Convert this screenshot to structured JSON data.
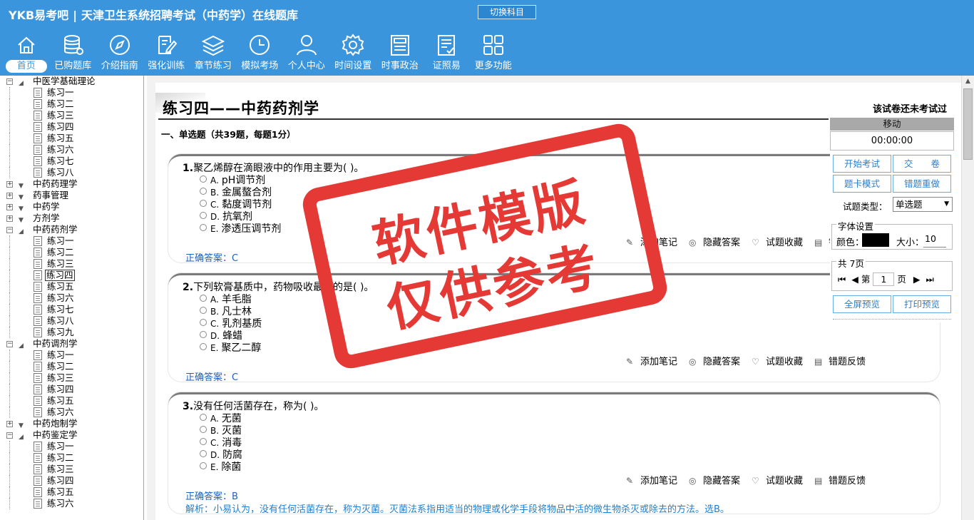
{
  "header": {
    "logo": "YKB易考吧",
    "title": "天津卫生系统招聘考试（中药学）在线题库",
    "switch_button": "切换科目"
  },
  "nav": [
    {
      "label": "首页",
      "icon": "home-icon"
    },
    {
      "label": "已购题库",
      "icon": "database-icon"
    },
    {
      "label": "介绍指南",
      "icon": "compass-icon"
    },
    {
      "label": "强化训练",
      "icon": "edit-icon"
    },
    {
      "label": "章节练习",
      "icon": "layers-icon"
    },
    {
      "label": "模拟考场",
      "icon": "clock-icon"
    },
    {
      "label": "个人中心",
      "icon": "user-icon"
    },
    {
      "label": "时间设置",
      "icon": "gear-icon"
    },
    {
      "label": "时事政治",
      "icon": "newspaper-icon"
    },
    {
      "label": "证照易",
      "icon": "checklist-icon"
    },
    {
      "label": "更多功能",
      "icon": "grid-icon"
    }
  ],
  "tree": [
    {
      "type": "cat",
      "label": "中医学基础理论",
      "expanded": true
    },
    {
      "type": "leaf",
      "label": "练习一"
    },
    {
      "type": "leaf",
      "label": "练习二"
    },
    {
      "type": "leaf",
      "label": "练习三"
    },
    {
      "type": "leaf",
      "label": "练习四"
    },
    {
      "type": "leaf",
      "label": "练习五"
    },
    {
      "type": "leaf",
      "label": "练习六"
    },
    {
      "type": "leaf",
      "label": "练习七"
    },
    {
      "type": "leaf",
      "label": "练习八"
    },
    {
      "type": "cat",
      "label": "中药药理学",
      "expanded": false
    },
    {
      "type": "cat",
      "label": "药事管理",
      "expanded": false
    },
    {
      "type": "cat",
      "label": "中药学",
      "expanded": false
    },
    {
      "type": "cat",
      "label": "方剂学",
      "expanded": false
    },
    {
      "type": "cat",
      "label": "中药药剂学",
      "expanded": true
    },
    {
      "type": "leaf",
      "label": "练习一"
    },
    {
      "type": "leaf",
      "label": "练习二"
    },
    {
      "type": "leaf",
      "label": "练习三"
    },
    {
      "type": "leaf",
      "label": "练习四",
      "selected": true
    },
    {
      "type": "leaf",
      "label": "练习五"
    },
    {
      "type": "leaf",
      "label": "练习六"
    },
    {
      "type": "leaf",
      "label": "练习七"
    },
    {
      "type": "leaf",
      "label": "练习八"
    },
    {
      "type": "leaf",
      "label": "练习九"
    },
    {
      "type": "cat",
      "label": "中药调剂学",
      "expanded": true
    },
    {
      "type": "leaf",
      "label": "练习一"
    },
    {
      "type": "leaf",
      "label": "练习二"
    },
    {
      "type": "leaf",
      "label": "练习三"
    },
    {
      "type": "leaf",
      "label": "练习四"
    },
    {
      "type": "leaf",
      "label": "练习五"
    },
    {
      "type": "leaf",
      "label": "练习六"
    },
    {
      "type": "cat",
      "label": "中药炮制学",
      "expanded": false
    },
    {
      "type": "cat",
      "label": "中药鉴定学",
      "expanded": true
    },
    {
      "type": "leaf",
      "label": "练习一"
    },
    {
      "type": "leaf",
      "label": "练习二"
    },
    {
      "type": "leaf",
      "label": "练习三"
    },
    {
      "type": "leaf",
      "label": "练习四"
    },
    {
      "type": "leaf",
      "label": "练习五"
    },
    {
      "type": "leaf",
      "label": "练习六"
    }
  ],
  "paper": {
    "title": "练习四——中药药剂学",
    "status": "该试卷还未考试过",
    "section": "一、单选题（共39题，每题1分）"
  },
  "questions": [
    {
      "num": "1.",
      "text": "聚乙烯醇在滴眼液中的作用主要为( )。",
      "options": [
        {
          "key": "A.",
          "text": "pH调节剂"
        },
        {
          "key": "B.",
          "text": "金属螯合剂"
        },
        {
          "key": "C.",
          "text": "黏度调节剂"
        },
        {
          "key": "D.",
          "text": "抗氧剂"
        },
        {
          "key": "E.",
          "text": "渗透压调节剂"
        }
      ],
      "answer": "正确答案：C",
      "analysis": ""
    },
    {
      "num": "2.",
      "text": "下列软膏基质中，药物吸收最好的是( )。",
      "options": [
        {
          "key": "A.",
          "text": "羊毛脂"
        },
        {
          "key": "B.",
          "text": "凡士林"
        },
        {
          "key": "C.",
          "text": "乳剂基质"
        },
        {
          "key": "D.",
          "text": "蜂蜡"
        },
        {
          "key": "E.",
          "text": "聚乙二醇"
        }
      ],
      "answer": "正确答案：C",
      "analysis": ""
    },
    {
      "num": "3.",
      "text": "没有任何活菌存在，称为( )。",
      "options": [
        {
          "key": "A.",
          "text": "无菌"
        },
        {
          "key": "B.",
          "text": "灭菌"
        },
        {
          "key": "C.",
          "text": "消毒"
        },
        {
          "key": "D.",
          "text": "防腐"
        },
        {
          "key": "E.",
          "text": "除菌"
        }
      ],
      "answer": "正确答案：B",
      "analysis": "解析：小易认为，没有任何活菌存在，称为灭菌。灭菌法系指用适当的物理或化学手段将物品中活的微生物杀灭或除去的方法。选B。"
    }
  ],
  "actions": {
    "note": "添加笔记",
    "hide": "隐藏答案",
    "fav": "试题收藏",
    "report": "错题反馈"
  },
  "panel": {
    "move": "移动",
    "timer": "00:00:00",
    "start": "开始考试",
    "submit": "交　　卷",
    "card_mode": "题卡模式",
    "redo": "错题重做",
    "qtype_label": "试题类型：",
    "qtype_value": "单选题",
    "font_legend": "字体设置",
    "color_label": "颜色：",
    "size_label": "大小：",
    "size_value": "10",
    "pages_legend": "共 7页",
    "page_prefix": "第",
    "page_value": "1",
    "page_suffix": "页",
    "fullscreen": "全屏预览",
    "print": "打印预览",
    "accent": "#3a95dd"
  },
  "stamp": {
    "line1": "软件模版",
    "line2": "仅供参考",
    "color": "#e53935"
  }
}
